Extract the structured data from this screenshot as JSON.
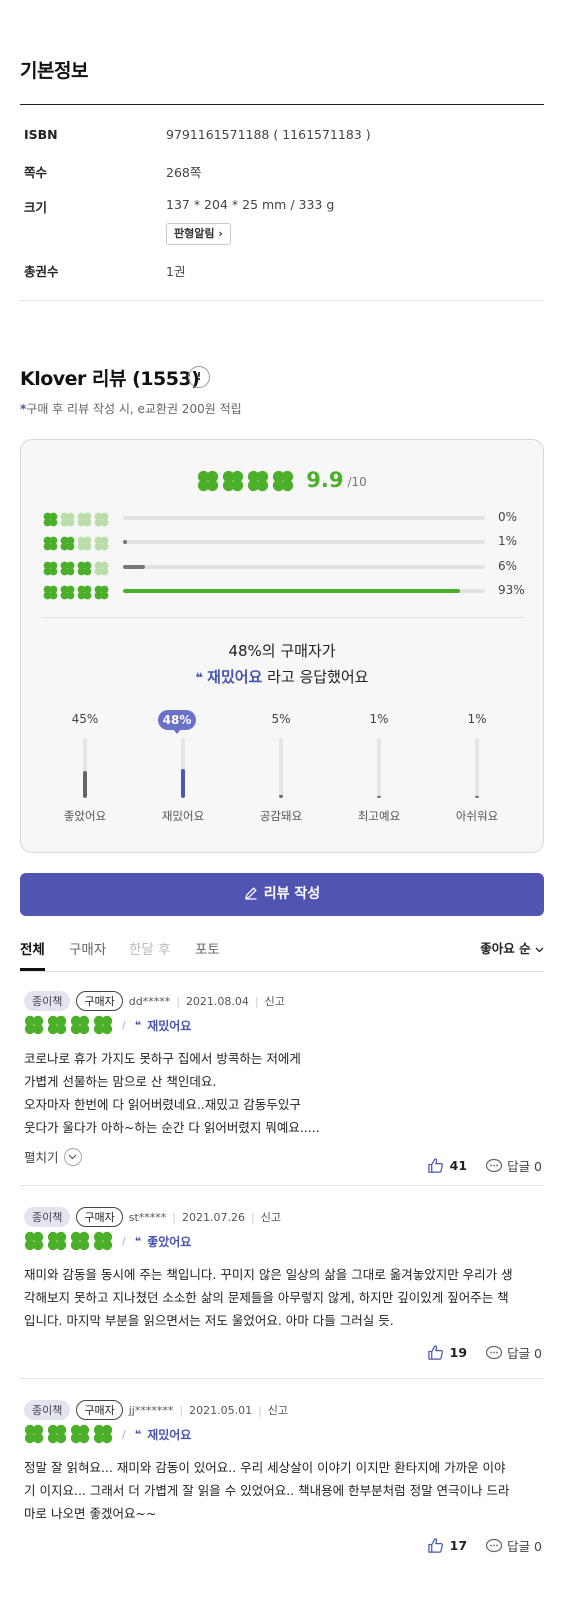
{
  "basic_info": {
    "title": "기본정보",
    "rows": [
      {
        "label": "ISBN",
        "value": "9791161571188 ( 1161571183 )"
      },
      {
        "label": "쪽수",
        "value": "268쪽"
      },
      {
        "label": "크기",
        "value": "137 * 204 * 25 mm / 333 g"
      },
      {
        "label": "총권수",
        "value": "1권"
      }
    ],
    "size_button": "판형알림 ›"
  },
  "klover": {
    "title": "Klover 리뷰 (1553)",
    "help": "!",
    "notice_mark": "*",
    "notice": "구매 후 리뷰 작성 시, e교환권 200원 적립",
    "score": "9.9",
    "score_max": "/10",
    "distribution": [
      {
        "clovers": 1,
        "percent": 0,
        "label": "0%"
      },
      {
        "clovers": 2,
        "percent": 1,
        "label": "1%"
      },
      {
        "clovers": 3,
        "percent": 6,
        "label": "6%"
      },
      {
        "clovers": 4,
        "percent": 93,
        "label": "93%"
      }
    ],
    "response_line1": "48%의 구매자가",
    "response_keyword": "재밌어요",
    "response_suffix": " 라고 응답했어요",
    "emotions": [
      {
        "label": "좋았어요",
        "pct": "45%",
        "value": 45
      },
      {
        "label": "재밌어요",
        "pct": "48%",
        "value": 48,
        "highlight": true
      },
      {
        "label": "공감돼요",
        "pct": "5%",
        "value": 5
      },
      {
        "label": "최고예요",
        "pct": "1%",
        "value": 1
      },
      {
        "label": "아쉬워요",
        "pct": "1%",
        "value": 1
      }
    ],
    "write_button": "리뷰 작성"
  },
  "tabs": {
    "items": [
      "전체",
      "구매자",
      "한달 후",
      "포토"
    ],
    "active": 0,
    "sort_label": "좋아요 순"
  },
  "reviews": [
    {
      "tag_type": "종이책",
      "tag_buyer": "구매자",
      "user": "dd*****",
      "date": "2021.08.04",
      "report": "신고",
      "emotion": "재밌어요",
      "lines": [
        "코로나로 휴가 가지도 못하구 집에서 방콕하는 저에게",
        "가볍게 선물하는 맘으로 산 책인데요.",
        "오자마자 한번에 다 읽어버렸네요..재밌고 감동두있구",
        "웃다가 울다가 아하~하는 순간 다 읽어버렸지 뭐예요....."
      ],
      "expand": "펼치기",
      "likes": "41",
      "reply": "답글 0"
    },
    {
      "tag_type": "종이책",
      "tag_buyer": "구매자",
      "user": "st*****",
      "date": "2021.07.26",
      "report": "신고",
      "emotion": "좋았어요",
      "lines": [
        "재미와 감동을 동시에 주는 책입니다. 꾸미지 않은 일상의 삶을 그대로 옮겨놓았지만 우리가 생",
        "각해보지 못하고 지나쳤던 소소한 삶의 문제들을 아무렇지 않게, 하지만 깊이있게 짚어주는 책",
        "입니다. 마지막 부분을 읽으면서는 저도 울었어요. 아마 다들 그러실 듯."
      ],
      "likes": "19",
      "reply": "답글 0"
    },
    {
      "tag_type": "종이책",
      "tag_buyer": "구매자",
      "user": "jj*******",
      "date": "2021.05.01",
      "report": "신고",
      "emotion": "재밌어요",
      "lines": [
        "정말 잘 읽혀요... 재미와 감동이 있어요.. 우리 세상살이 이야기 이지만 환타지에 가까운 이야",
        "기 이지요... 그래서 더 가볍게 잘 읽을 수 있었어요.. 책내용에 한부분처럼 정말 연극이나 드라",
        "마로 나오면 좋겠어요~~"
      ],
      "likes": "17",
      "reply": "답글 0"
    }
  ],
  "colors": {
    "accent": "#5055b1",
    "clover_green": "#4caf2a",
    "clover_light": "#b9dea8",
    "bar_gray": "#777777"
  },
  "icons": {
    "clover": "clover-icon",
    "pencil": "pencil-icon",
    "thumb": "thumbs-up-icon",
    "comment": "comment-icon",
    "chevron": "chevron-down-icon",
    "quote": "quote-icon"
  }
}
